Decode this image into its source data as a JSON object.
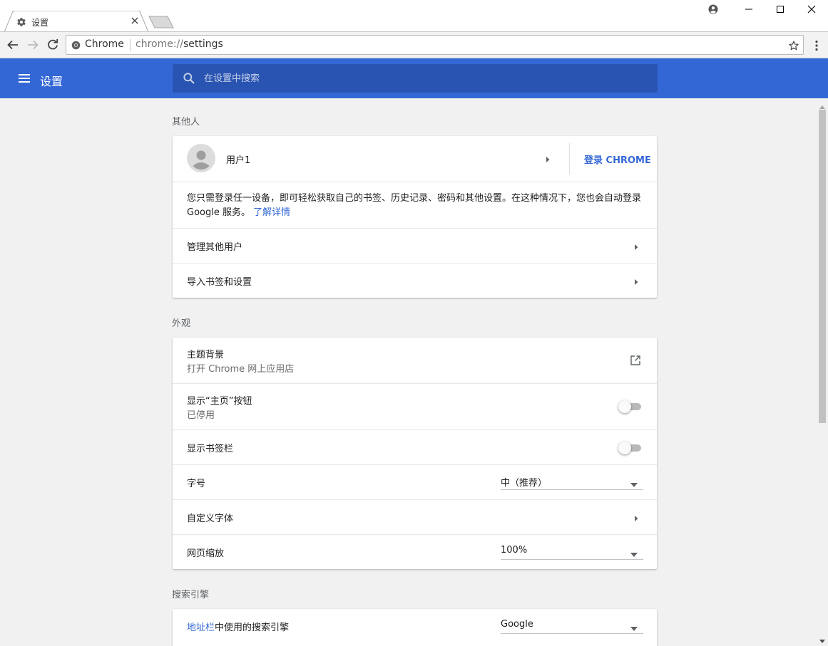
{
  "window": {
    "tab_title": "设置",
    "tab_icon": "gear-icon"
  },
  "toolbar": {
    "omnibox_chip": "Chrome",
    "omnibox_url_scheme": "chrome://",
    "omnibox_url_path": "settings"
  },
  "header": {
    "title": "设置",
    "search_placeholder": "在设置中搜索",
    "color": "#3367d6"
  },
  "people": {
    "section_title": "其他人",
    "user_name": "用户1",
    "signin_button": "登录 CHROME",
    "signin_desc_line1": "您只需登录任一设备，即可轻松获取自己的书签、历史记录、密码和其他设置。在这种情况下，您也会自动登录",
    "signin_desc_line2": "Google 服务。",
    "learn_more": "了解详情",
    "manage_users": "管理其他用户",
    "import": "导入书签和设置"
  },
  "appearance": {
    "section_title": "外观",
    "theme_label": "主题背景",
    "theme_sub": "打开 Chrome 网上应用店",
    "home_label": "显示“主页”按钮",
    "home_sub": "已停用",
    "home_enabled": false,
    "bookmarks_label": "显示书签栏",
    "bookmarks_enabled": false,
    "font_size_label": "字号",
    "font_size_value": "中（推荐）",
    "custom_fonts_label": "自定义字体",
    "zoom_label": "网页缩放",
    "zoom_value": "100%"
  },
  "search_engine": {
    "section_title": "搜索引擎",
    "label_link": "地址栏",
    "label_rest": "中使用的搜索引擎",
    "value": "Google"
  }
}
